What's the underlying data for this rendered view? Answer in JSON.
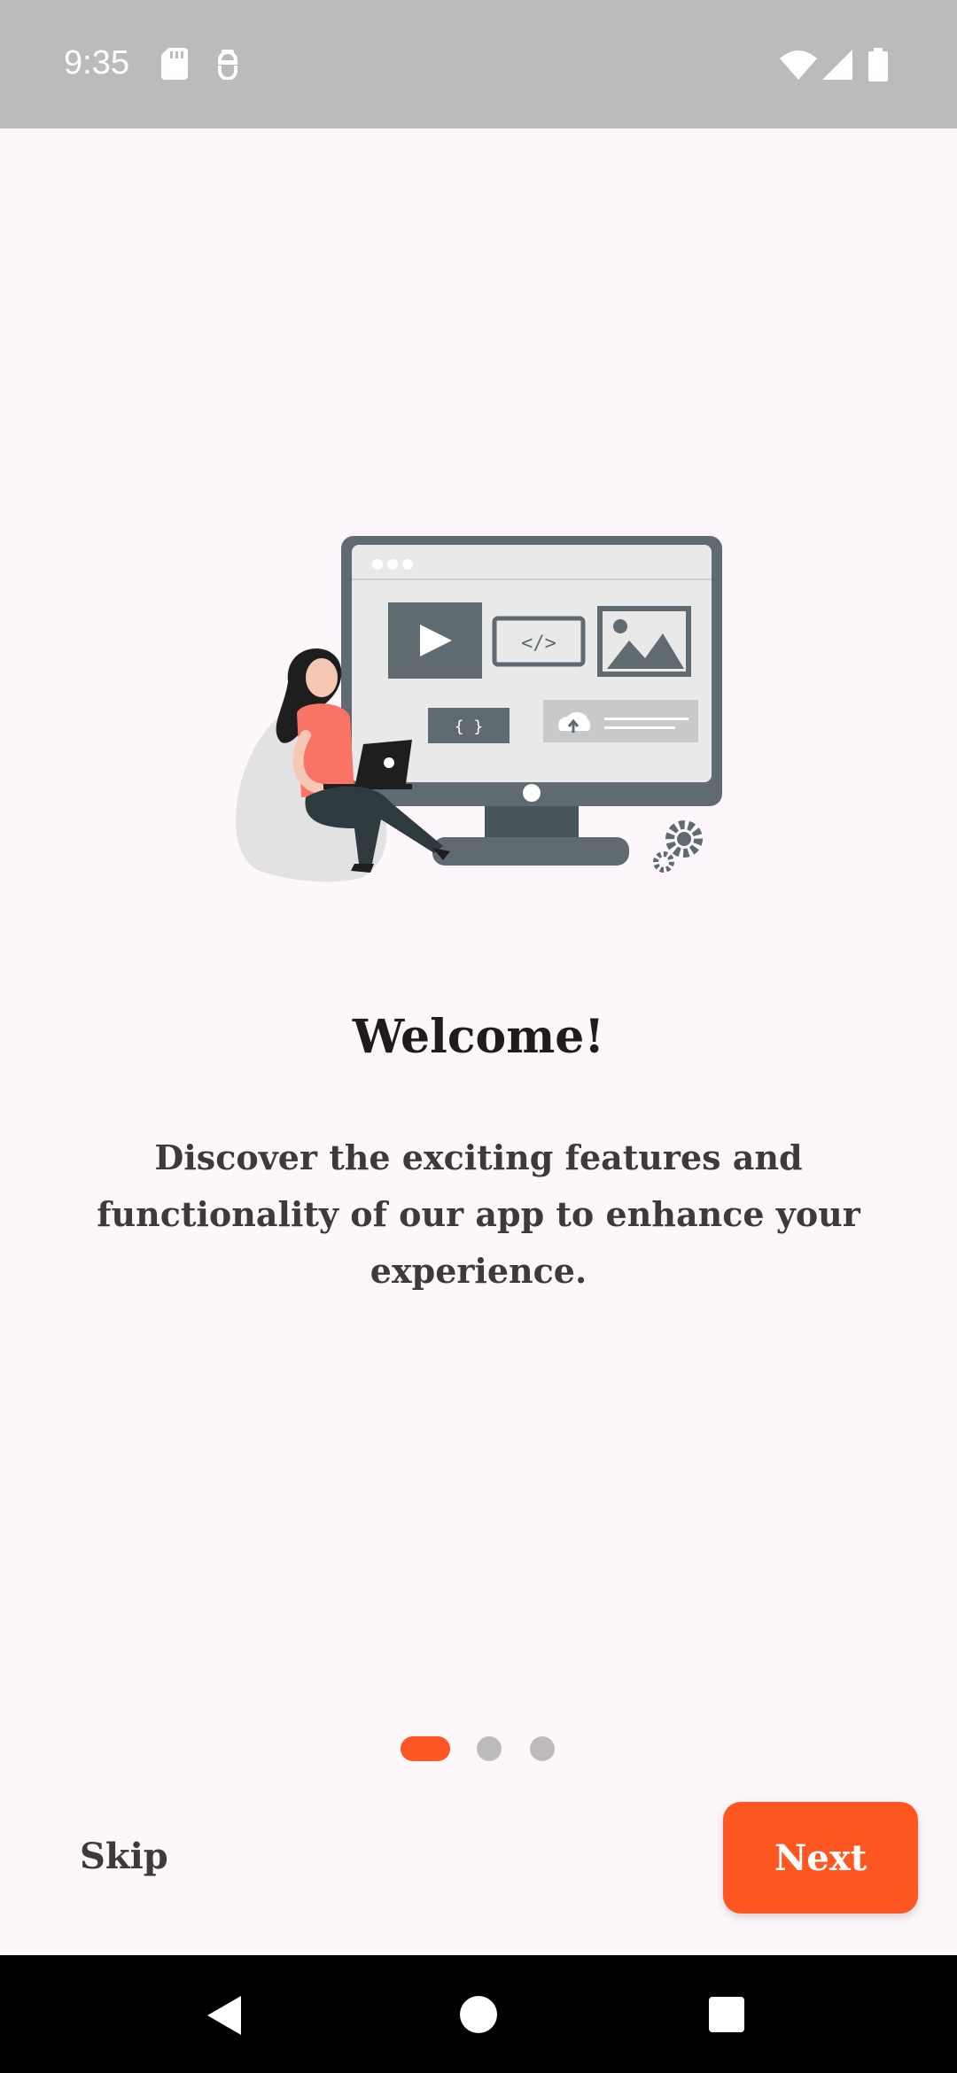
{
  "status_bar": {
    "time": "9:35",
    "left_icons": [
      "sd-card-icon",
      "headset-icon"
    ],
    "right_icons": [
      "wifi-icon",
      "signal-icon",
      "battery-icon"
    ],
    "background": "#bdbabd"
  },
  "onboarding": {
    "title": "Welcome!",
    "description": "Discover the exciting features and functionality of our app to enhance your experience.",
    "page_indicator": {
      "total_pages": 3,
      "current_page": 1,
      "active_color": "#ff5722",
      "inactive_color": "#bdbabd"
    },
    "skip_label": "Skip",
    "next_label": "Next"
  },
  "colors": {
    "accent": "#ff5722",
    "background": "#fdf7fb",
    "illustration_primary": "#5f6b70",
    "illustration_accent": "#fa7466"
  },
  "nav_bar": {
    "buttons": [
      "back-icon",
      "home-icon",
      "recents-icon"
    ]
  }
}
